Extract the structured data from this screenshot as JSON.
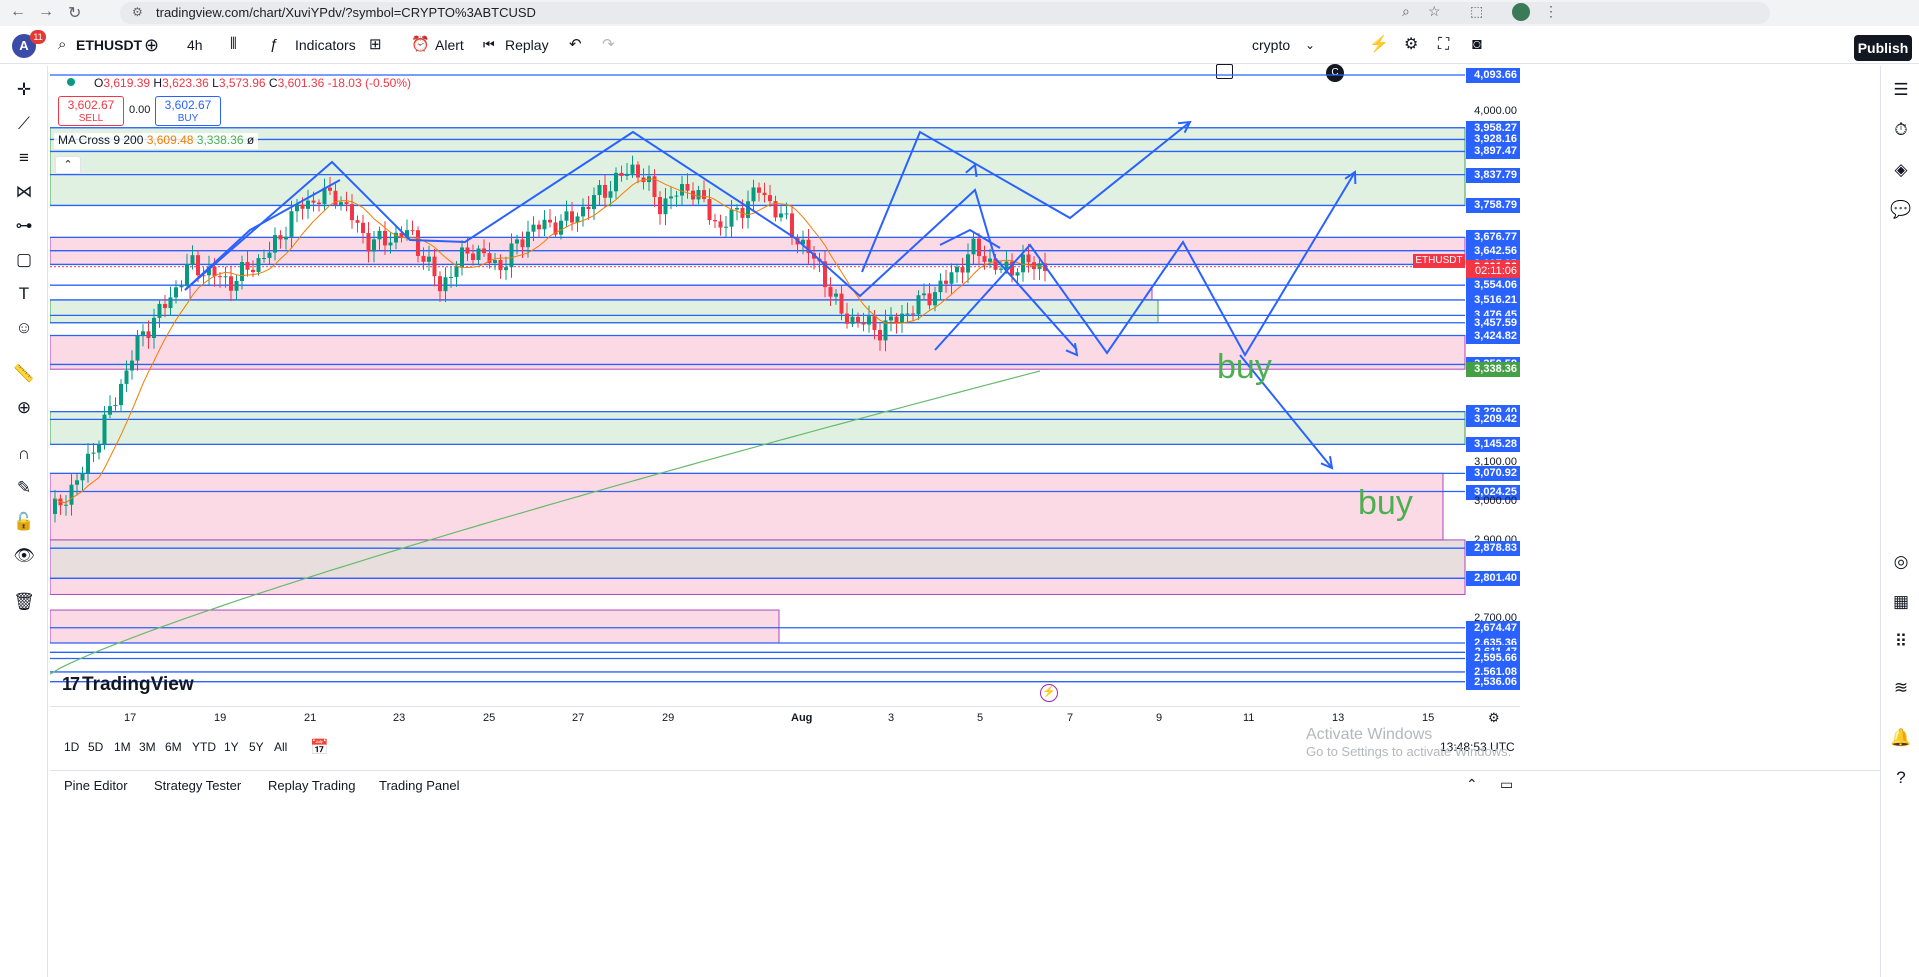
{
  "browser": {
    "url": "tradingview.com/chart/XuviYPdv/?symbol=CRYPTO%3ABTCUSD"
  },
  "toolbar": {
    "avatar_letter": "A",
    "notif_count": "11",
    "symbol": "ETHUSDT",
    "interval": "4h",
    "indicators_label": "Indicators",
    "alert_label": "Alert",
    "replay_label": "Replay",
    "layout_name": "crypto",
    "layout_badge": "C",
    "publish_label": "Publish"
  },
  "legend": {
    "ohlc_o_label": "O",
    "ohlc_o": "3,619.39",
    "ohlc_h_label": "H",
    "ohlc_h": "3,623.36",
    "ohlc_l_label": "L",
    "ohlc_l": "3,573.96",
    "ohlc_c_label": "C",
    "ohlc_c": "3,601.36",
    "change": "-18.03 (-0.50%)",
    "sell_price": "3,602.67",
    "sell_label": "SELL",
    "spread": "0.00",
    "buy_price": "3,602.67",
    "buy_label": "BUY",
    "ma_name": "MA Cross 9 200",
    "ma_fast": "3,609.48",
    "ma_slow": "3,338.36",
    "ma_suffix": "ø"
  },
  "price_axis": {
    "labels": [
      {
        "value": "4,093.66",
        "style": "line"
      },
      {
        "value": "4,000.00",
        "style": "plain"
      },
      {
        "value": "3,958.27",
        "style": "line"
      },
      {
        "value": "3,928.16",
        "style": "line"
      },
      {
        "value": "3,897.47",
        "style": "line"
      },
      {
        "value": "3,837.79",
        "style": "line"
      },
      {
        "value": "3,758.79",
        "style": "line"
      },
      {
        "value": "3,676.77",
        "style": "line"
      },
      {
        "value": "3,642.56",
        "style": "line"
      },
      {
        "value": "3,609.48",
        "style": "ma_fast"
      },
      {
        "value": "3,607.35",
        "style": "line"
      },
      {
        "value": "3,601.36",
        "style": "last"
      },
      {
        "value": "3,554.06",
        "style": "line"
      },
      {
        "value": "3,516.21",
        "style": "line"
      },
      {
        "value": "3,476.45",
        "style": "line"
      },
      {
        "value": "3,457.59",
        "style": "line"
      },
      {
        "value": "3,424.82",
        "style": "line"
      },
      {
        "value": "3,350.58",
        "style": "line"
      },
      {
        "value": "3,338.36",
        "style": "ma_slow"
      },
      {
        "value": "3,229.40",
        "style": "line"
      },
      {
        "value": "3,209.42",
        "style": "line"
      },
      {
        "value": "3,145.28",
        "style": "line"
      },
      {
        "value": "3,100.00",
        "style": "plain"
      },
      {
        "value": "3,070.92",
        "style": "line"
      },
      {
        "value": "3,024.25",
        "style": "line"
      },
      {
        "value": "3,000.00",
        "style": "plain"
      },
      {
        "value": "2,900.00",
        "style": "plain"
      },
      {
        "value": "2,878.83",
        "style": "line"
      },
      {
        "value": "2,801.40",
        "style": "line"
      },
      {
        "value": "2,700.00",
        "style": "plain"
      },
      {
        "value": "2,674.47",
        "style": "line"
      },
      {
        "value": "2,635.36",
        "style": "line"
      },
      {
        "value": "2,611.47",
        "style": "line"
      },
      {
        "value": "2,595.66",
        "style": "line"
      },
      {
        "value": "2,561.08",
        "style": "line"
      },
      {
        "value": "2,536.06",
        "style": "line"
      }
    ],
    "symbol_tag": "ETHUSDT",
    "countdown": "02:11:06"
  },
  "time_axis": {
    "labels": [
      "17",
      "19",
      "21",
      "23",
      "25",
      "27",
      "29",
      "Aug",
      "3",
      "5",
      "7",
      "9",
      "11",
      "13",
      "15"
    ]
  },
  "annotations": {
    "buy_text": "buy"
  },
  "brand": {
    "logo_text": "TradingView"
  },
  "range_bar": {
    "ranges": [
      "1D",
      "5D",
      "1M",
      "3M",
      "6M",
      "YTD",
      "1Y",
      "5Y",
      "All"
    ],
    "clock": "13:48:53 UTC"
  },
  "bottom_panels": {
    "tabs": [
      "Pine Editor",
      "Strategy Tester",
      "Replay Trading",
      "Trading Panel"
    ]
  },
  "os_watermark": {
    "line1": "Activate Windows",
    "line2": "Go to Settings to activate Windows."
  },
  "colors": {
    "bull": "#089981",
    "bear": "#f23645",
    "accent": "#2962ff",
    "zone_green": "#c8e6c9",
    "zone_pink": "#f8bbd0",
    "ma_fast": "#f57c00",
    "ma_slow": "#66bb6a"
  }
}
